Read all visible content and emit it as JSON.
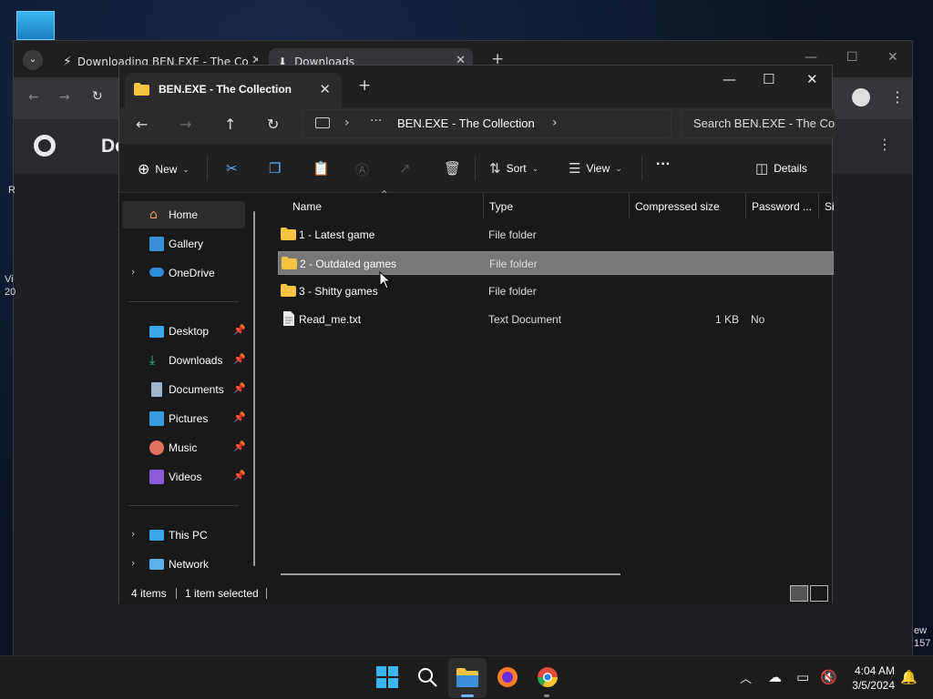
{
  "chrome": {
    "tabs": [
      {
        "label": "Downloading BEN.EXE - The Co"
      },
      {
        "label": "Downloads"
      }
    ],
    "page_title": "Dow",
    "left_edge_texts": [
      "R",
      "Vi",
      "20"
    ],
    "right_edge_texts": [
      "ew",
      "157"
    ]
  },
  "explorer": {
    "tab_title": "BEN.EXE - The Collection",
    "address": {
      "breadcrumb": "BEN.EXE - The Collection",
      "overflow": "···"
    },
    "search_placeholder": "Search BEN.EXE - The Col",
    "commands": {
      "new": "New",
      "sort": "Sort",
      "view": "View",
      "more": "···",
      "details": "Details"
    },
    "sidebar": {
      "top": [
        {
          "label": "Home"
        },
        {
          "label": "Gallery"
        },
        {
          "label": "OneDrive"
        }
      ],
      "pinned": [
        {
          "label": "Desktop"
        },
        {
          "label": "Downloads"
        },
        {
          "label": "Documents"
        },
        {
          "label": "Pictures"
        },
        {
          "label": "Music"
        },
        {
          "label": "Videos"
        }
      ],
      "bottom": [
        {
          "label": "This PC"
        },
        {
          "label": "Network"
        }
      ]
    },
    "columns": [
      "Name",
      "Type",
      "Compressed size",
      "Password ...",
      "Si"
    ],
    "files": [
      {
        "name": "1 - Latest game",
        "type": "File folder",
        "size": "",
        "password": ""
      },
      {
        "name": "2 - Outdated games",
        "type": "File folder",
        "size": "",
        "password": ""
      },
      {
        "name": "3 - Shitty games",
        "type": "File folder",
        "size": "",
        "password": ""
      },
      {
        "name": "Read_me.txt",
        "type": "Text Document",
        "size": "1 KB",
        "password": "No"
      }
    ],
    "status": {
      "items": "4 items",
      "selected": "1 item selected"
    }
  },
  "taskbar": {
    "time": "4:04 AM",
    "date": "3/5/2024"
  },
  "colors": {
    "accent": "#69b6ff",
    "folder": "#f5c342",
    "selection": "#777777"
  }
}
